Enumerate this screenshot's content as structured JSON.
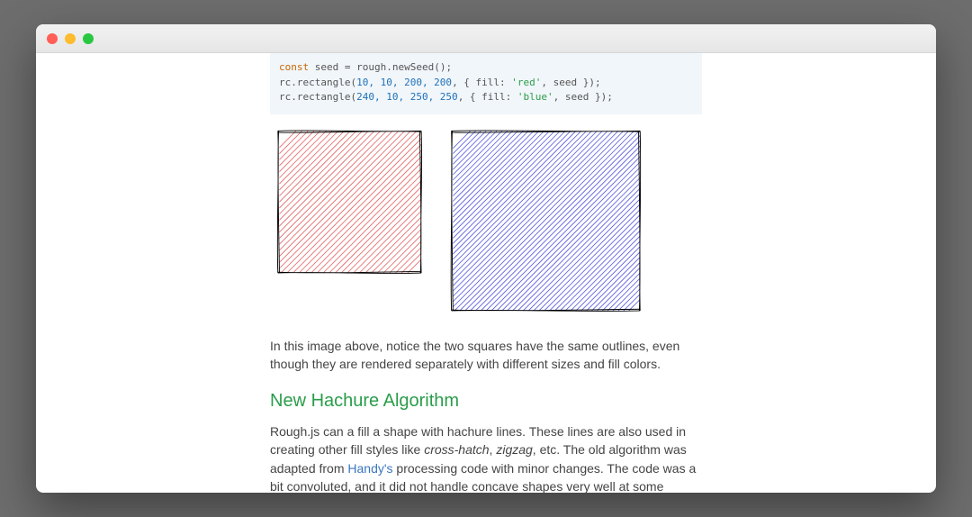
{
  "code": {
    "line1_kw": "const",
    "line1_rest": " seed = rough.newSeed();",
    "line2_pre": "rc.rectangle(",
    "line2_nums": "10, 10, 200, 200",
    "line2_mid": ", { fill: ",
    "line2_str": "'red'",
    "line2_post": ", seed });",
    "line3_pre": "rc.rectangle(",
    "line3_nums": "240, 10, 250, 250",
    "line3_mid": ", { fill: ",
    "line3_str": "'blue'",
    "line3_post": ", seed });"
  },
  "para1": "In this image above, notice the two squares have the same outlines, even though they are rendered separately with different sizes and fill colors.",
  "heading_hachure": "New Hachure Algorithm",
  "para2_a": "Rough.js can a fill a shape with hachure lines. These lines are also used in creating other fill styles like ",
  "para2_em1": "cross-hatch",
  "para2_sep": ", ",
  "para2_em2": "zigzag",
  "para2_b": ", etc. The old algorithm was adapted from ",
  "para2_link": "Handy's",
  "para2_c": " processing code with minor changes. The code was a bit convoluted, and it did not handle concave shapes very well at some hachure angles, creating cases like these:",
  "figure": {
    "shape1": {
      "fill_color": "red",
      "size": 200
    },
    "shape2": {
      "fill_color": "blue",
      "size": 250
    }
  }
}
